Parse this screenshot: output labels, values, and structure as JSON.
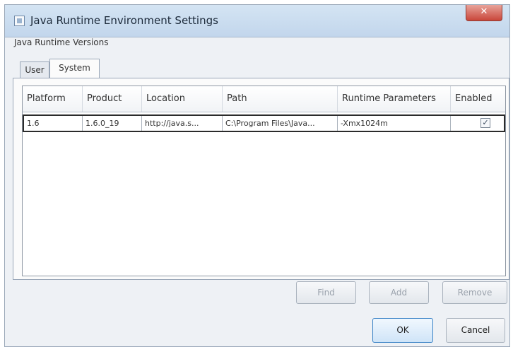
{
  "window": {
    "title": "Java Runtime Environment Settings",
    "close_glyph": "✕"
  },
  "section_label": "Java Runtime Versions",
  "tabs": [
    {
      "label": "User",
      "selected": false
    },
    {
      "label": "System",
      "selected": true
    }
  ],
  "table": {
    "columns": [
      "Platform",
      "Product",
      "Location",
      "Path",
      "Runtime Parameters",
      "Enabled"
    ],
    "rows": [
      {
        "platform": "1.6",
        "product": "1.6.0_19",
        "location": "http://java.s...",
        "path": "C:\\Program Files\\Java...",
        "runtime_parameters": "-Xmx1024m",
        "enabled": true,
        "enabled_glyph": "✓"
      }
    ]
  },
  "buttons": {
    "find": "Find",
    "add": "Add",
    "remove": "Remove",
    "ok": "OK",
    "cancel": "Cancel"
  }
}
